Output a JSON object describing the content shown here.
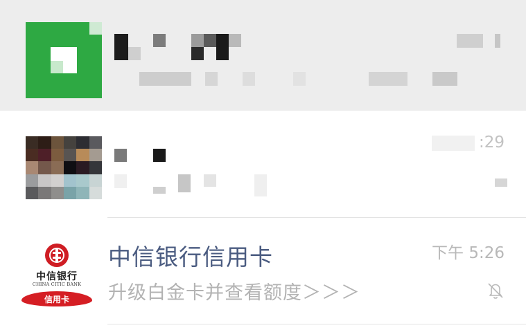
{
  "chats": [
    {
      "name": "",
      "preview": "",
      "time": "",
      "muted": false
    },
    {
      "name": "",
      "preview": "",
      "time": ":29",
      "muted": false
    },
    {
      "name": "中信银行信用卡",
      "preview": "升级白金卡并查看额度＞＞＞",
      "time": "下午 5:26",
      "muted": true,
      "avatar": {
        "name": "中信银行",
        "english": "CHINA CITIC BANK",
        "badge": "信用卡",
        "brand_color": "#d51e24"
      }
    }
  ],
  "icons": {
    "mute": "bell-slash-icon"
  }
}
